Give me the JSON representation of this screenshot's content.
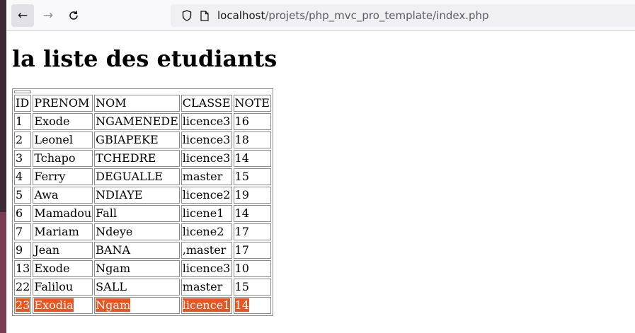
{
  "browser": {
    "url_host": "localhost",
    "url_path": "/projets/php_mvc_pro_template/index.php"
  },
  "page": {
    "title": "la liste des etudiants"
  },
  "table": {
    "headers": [
      "ID",
      "PRENOM",
      "NOM",
      "CLASSE",
      "NOTE"
    ],
    "rows": [
      [
        "1",
        "Exode",
        "NGAMENEDE",
        "licence3",
        "16"
      ],
      [
        "2",
        "Leonel",
        "GBIAPEKE",
        "licence3",
        "18"
      ],
      [
        "3",
        "Tchapo",
        "TCHEDRE",
        "licence3",
        "14"
      ],
      [
        "4",
        "Ferry",
        "DEGUALLE",
        "master",
        "15"
      ],
      [
        "5",
        "Awa",
        "NDIAYE",
        "licence2",
        "19"
      ],
      [
        "6",
        "Mamadou",
        "Fall",
        "licene1",
        "14"
      ],
      [
        "7",
        "Mariam",
        "Ndeye",
        "licene2",
        "17"
      ],
      [
        "9",
        "Jean",
        "BANA",
        ",master",
        "17"
      ],
      [
        "13",
        "Exode",
        "Ngam",
        "licence3",
        "10"
      ],
      [
        "22",
        "Falilou",
        "SALL",
        "master",
        "15"
      ],
      [
        "23",
        "Exodia",
        "Ngam",
        "licence1",
        "14"
      ]
    ],
    "selected_row_index": 10,
    "selection_color": "#e95420"
  },
  "icons": {
    "back": "arrow-left-icon",
    "forward": "arrow-right-icon",
    "reload": "reload-icon",
    "shield": "shield-icon",
    "page": "page-icon"
  }
}
